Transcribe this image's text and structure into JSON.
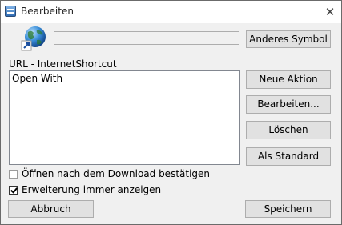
{
  "window": {
    "title": "Bearbeiten"
  },
  "icons": {
    "app": "app-window-icon",
    "close": "close-icon",
    "symbol": "internet-globe-shortcut-icon"
  },
  "symbol": {
    "field_value": "",
    "change_button": "Anderes Symbol"
  },
  "url": {
    "label": "URL - InternetShortcut",
    "actions": [
      "Open With"
    ]
  },
  "buttons": {
    "new_action": "Neue Aktion",
    "edit": "Bearbeiten...",
    "delete": "Löschen",
    "default": "Als Standard",
    "cancel": "Abbruch",
    "save": "Speichern"
  },
  "options": {
    "open_after_download": {
      "label": "Öffnen nach dem Download bestätigen",
      "checked": false
    },
    "always_show_extension": {
      "label": "Erweiterung immer anzeigen",
      "checked": true
    }
  }
}
